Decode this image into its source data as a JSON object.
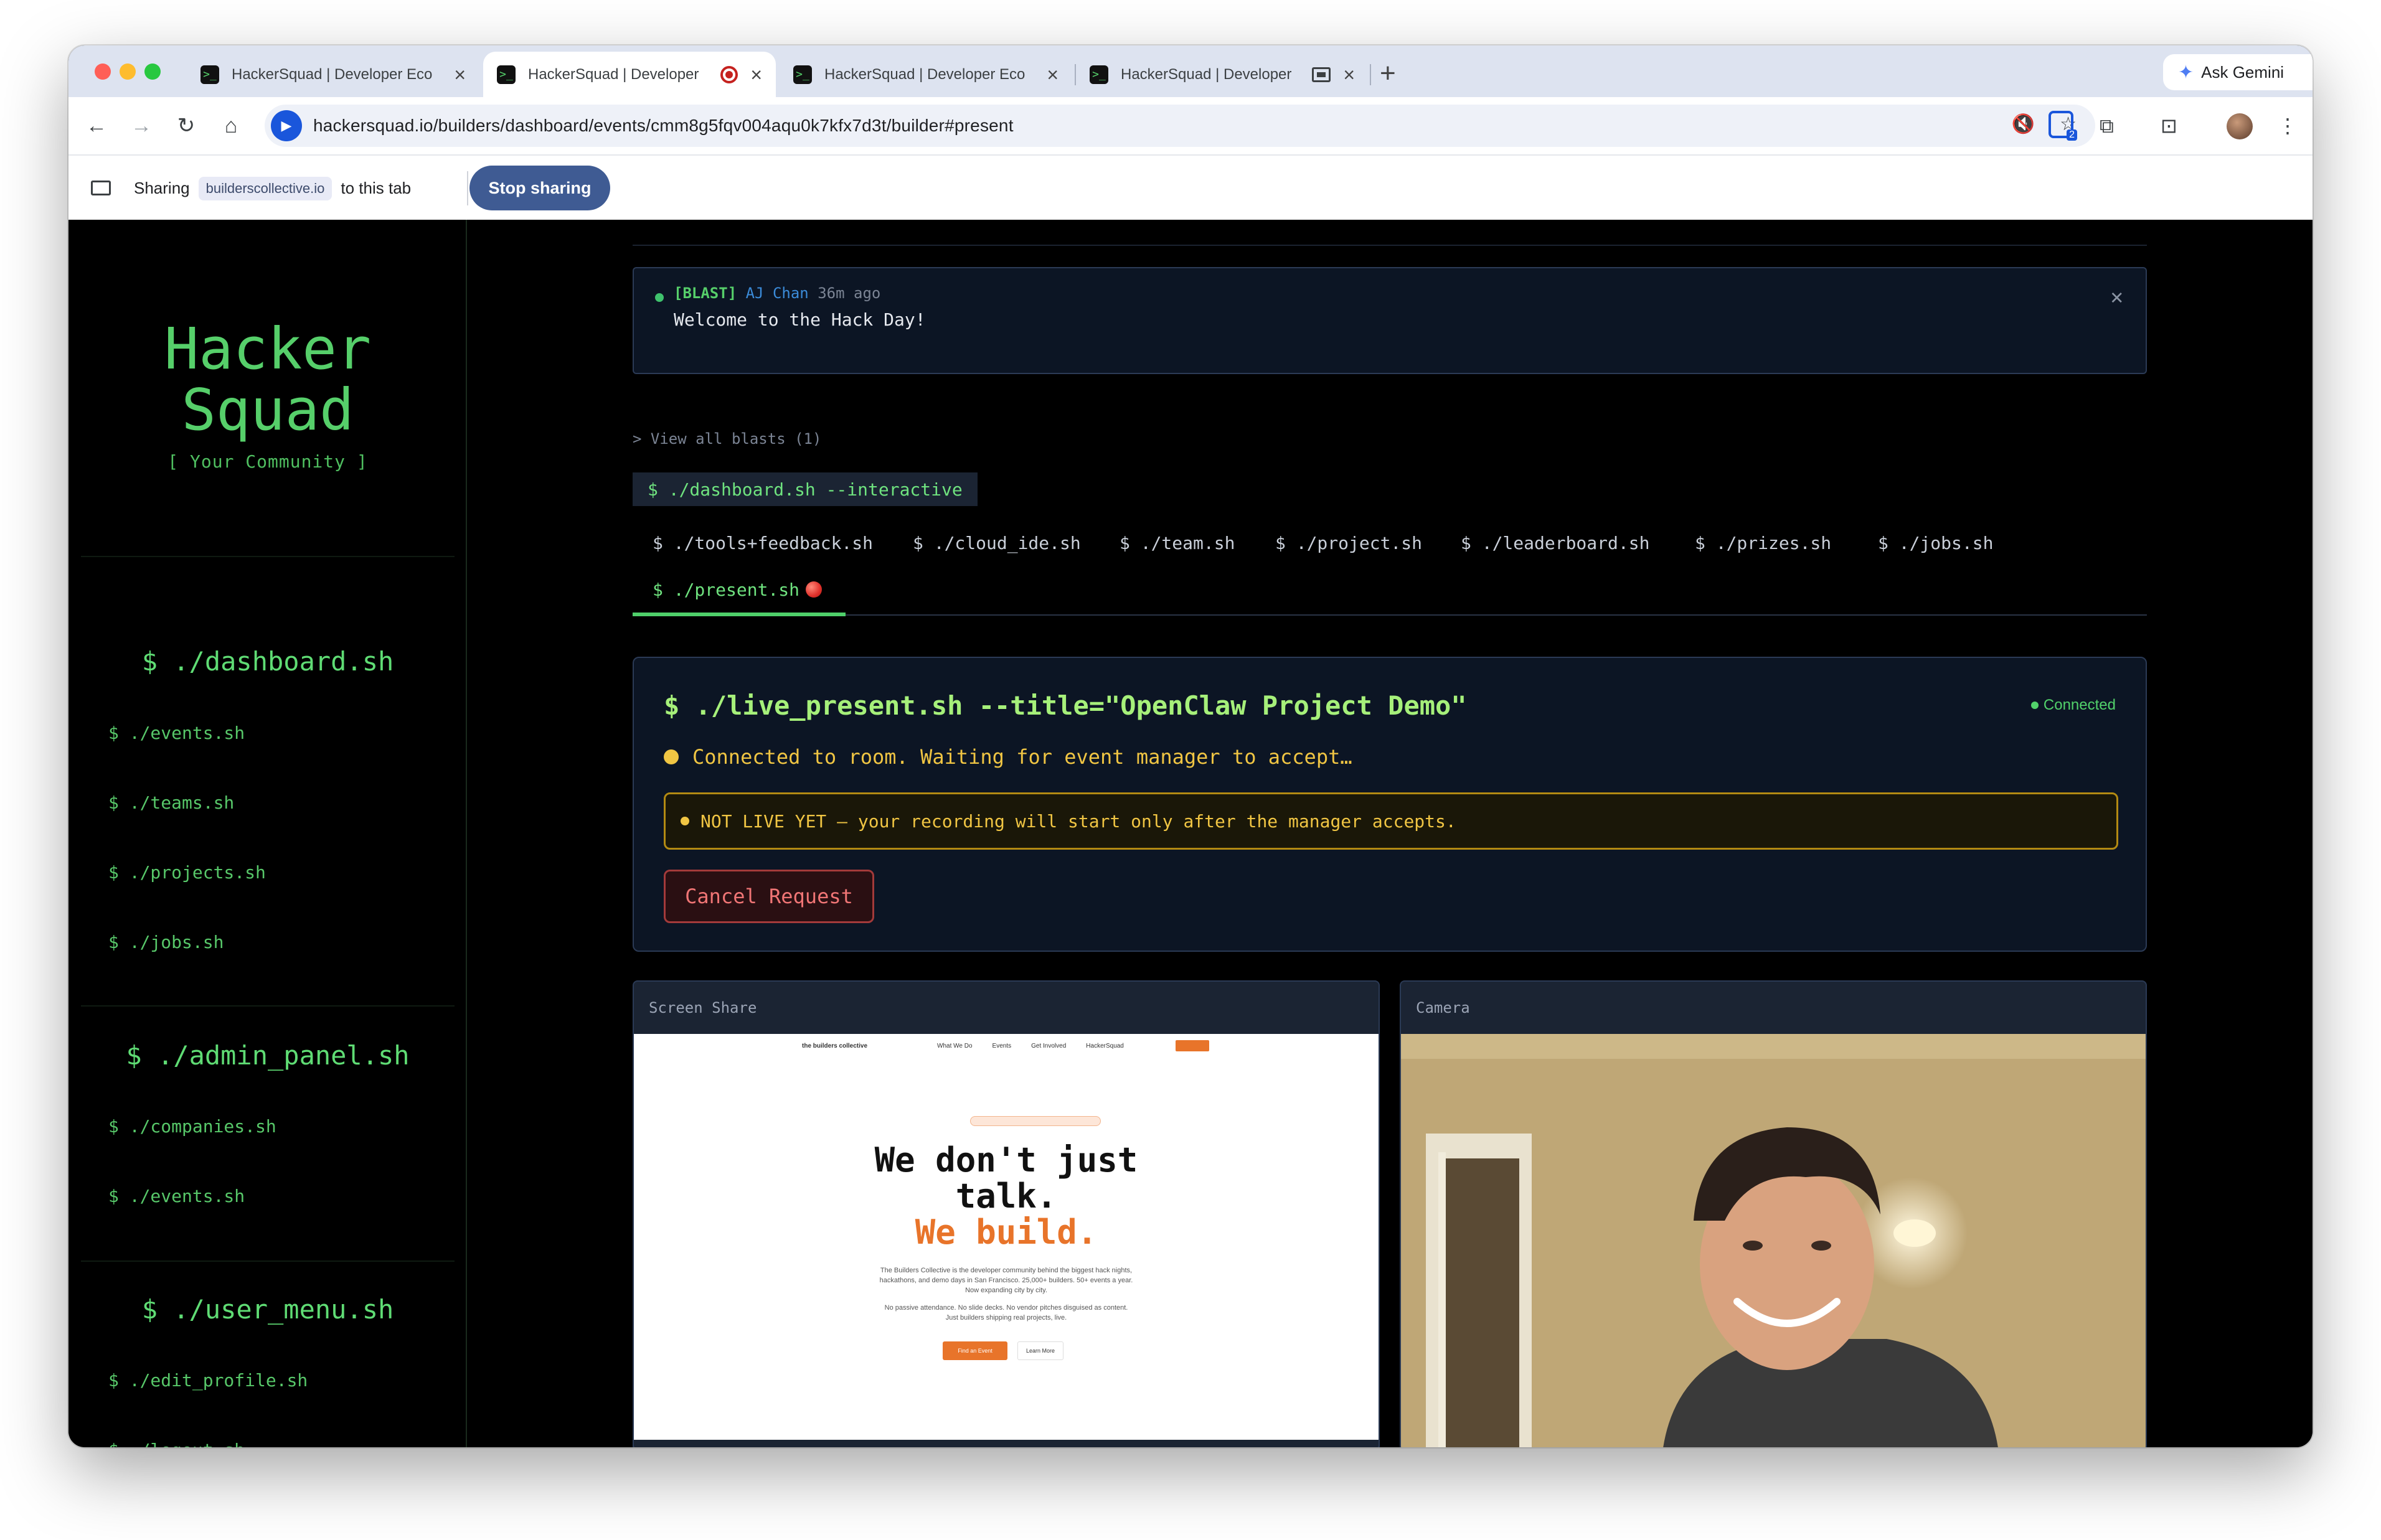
{
  "browser": {
    "tabs": [
      {
        "title": "HackerSquad | Developer Eco",
        "favicon": ">_",
        "active": false
      },
      {
        "title": "HackerSquad | Developer",
        "favicon": ">_",
        "active": true,
        "indicator": "recording-icon"
      },
      {
        "title": "HackerSquad | Developer Eco",
        "favicon": ">_",
        "active": false
      },
      {
        "title": "HackerSquad | Developer",
        "favicon": ">_",
        "active": false,
        "indicator": "cast-icon"
      }
    ],
    "ask_gemini": "Ask Gemini",
    "url": "hackersquad.io/builders/dashboard/events/cmm8g5fqv004aqu0k7kfx7d3t/builder#present",
    "extension_badge": "2"
  },
  "sharing_bar": {
    "prefix": "Sharing",
    "site": "builderscollective.io",
    "suffix": "to this tab",
    "stop_label": "Stop sharing"
  },
  "sidebar": {
    "brand_line1": "Hacker",
    "brand_line2": "Squad",
    "tagline": "[ Your Community ]",
    "sections": [
      {
        "heading": "$ ./dashboard.sh",
        "items": [
          "$ ./events.sh",
          "$ ./teams.sh",
          "$ ./projects.sh",
          "$ ./jobs.sh"
        ]
      },
      {
        "heading": "$ ./admin_panel.sh",
        "items": [
          "$ ./companies.sh",
          "$ ./events.sh"
        ]
      },
      {
        "heading": "$ ./user_menu.sh",
        "items": [
          "$ ./edit_profile.sh",
          "$ ./logout.sh"
        ]
      }
    ]
  },
  "blast": {
    "tag": "[BLAST]",
    "author": "AJ Chan",
    "time": "36m ago",
    "message": "Welcome to the Hack Day!",
    "view_all": "View all blasts (1)"
  },
  "command_pill": "$ ./dashboard.sh --interactive",
  "tabs_row1": [
    "$ ./tools+feedback.sh",
    "$ ./cloud_ide.sh",
    "$ ./team.sh",
    "$ ./project.sh",
    "$ ./leaderboard.sh",
    "$ ./prizes.sh",
    "$ ./jobs.sh"
  ],
  "tab_active": "$ ./present.sh",
  "present": {
    "title": "$ ./live_present.sh --title=\"OpenClaw Project Demo\"",
    "connection": "Connected",
    "status": "Connected to room. Waiting for event manager to accept…",
    "warning": "NOT LIVE YET — your recording will start only after the manager accepts.",
    "cancel_label": "Cancel Request"
  },
  "screen_share": {
    "label": "Screen Share",
    "site_name": "the builders collective",
    "nav": [
      "What We Do",
      "Events",
      "Get Involved",
      "HackerSquad"
    ],
    "headline_1": "We don't just",
    "headline_2": "talk.",
    "headline_3": "We build.",
    "body_1": "The Builders Collective is the developer community behind the biggest hack nights,",
    "body_2": "hackathons, and demo days in San Francisco. 25,000+ builders. 50+ events a year.",
    "body_3": "Now expanding city by city.",
    "body_4": "No passive attendance. No slide decks. No vendor pitches disguised as content.",
    "body_5": "Just builders shipping real projects, live.",
    "cta_primary": "Find an Event",
    "cta_secondary": "Learn More"
  },
  "camera": {
    "label": "Camera"
  }
}
